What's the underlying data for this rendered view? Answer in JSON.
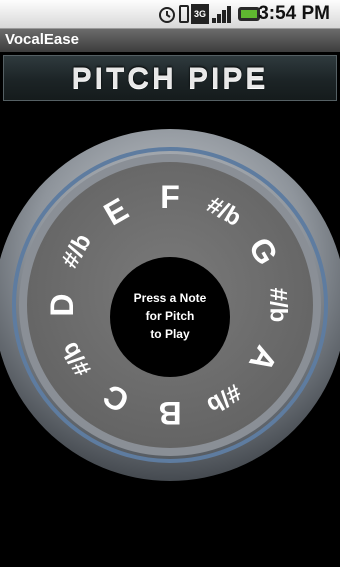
{
  "status_bar": {
    "time": "3:54 PM",
    "network_type": "3G",
    "icons": [
      "alarm-icon",
      "vibrate-icon",
      "data-3g-icon",
      "signal-icon",
      "battery-icon"
    ]
  },
  "app": {
    "title": "VocalEase"
  },
  "header": {
    "title": "PITCH PIPE"
  },
  "pitch_pipe": {
    "center_text": [
      "Press a Note",
      "for Pitch",
      "to Play"
    ],
    "notes": [
      {
        "label": "F"
      },
      {
        "label": "#/b"
      },
      {
        "label": "G"
      },
      {
        "label": "#/b"
      },
      {
        "label": "A"
      },
      {
        "label": "#/b"
      },
      {
        "label": "B"
      },
      {
        "label": "C"
      },
      {
        "label": "#/b"
      },
      {
        "label": "D"
      },
      {
        "label": "#/b"
      },
      {
        "label": "E"
      }
    ]
  },
  "colors": {
    "background": "#000000",
    "ring_face": "#6e6e6e",
    "note_text": "#ffffff",
    "bezel": "#9aa1a8"
  }
}
